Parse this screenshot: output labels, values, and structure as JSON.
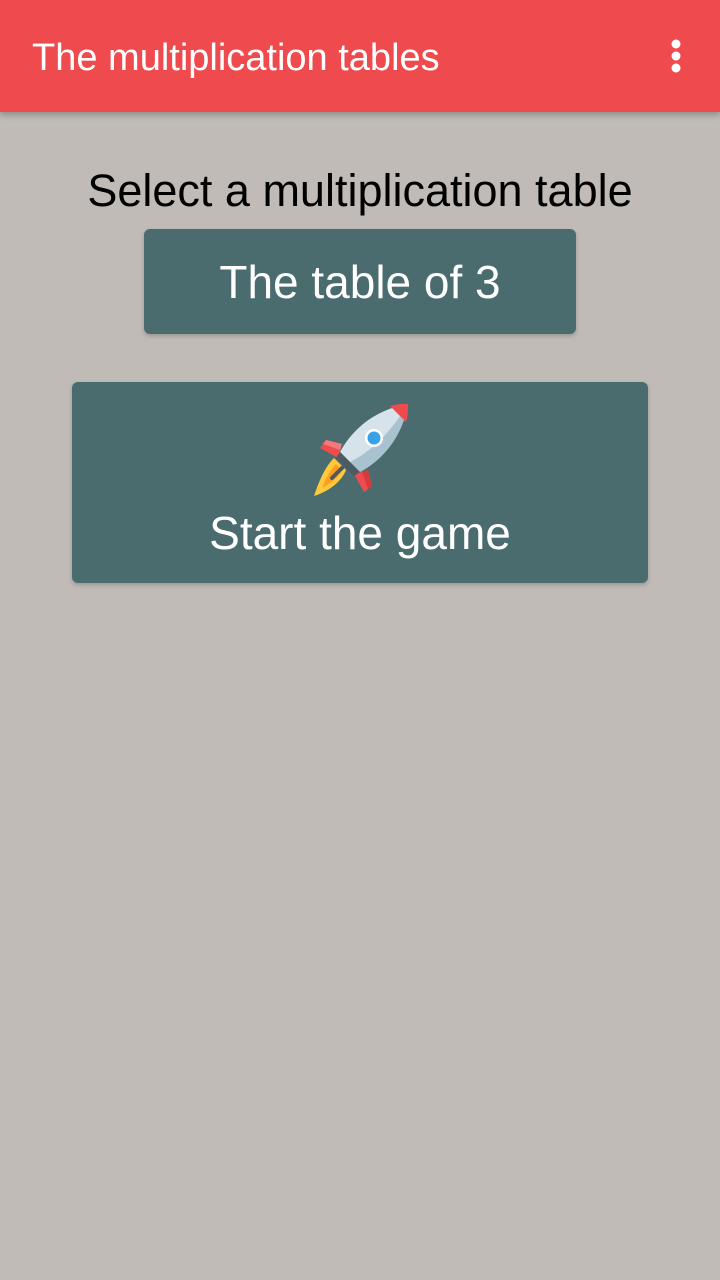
{
  "app_bar": {
    "title": "The multiplication tables",
    "background_color": "#ef4a4d",
    "overflow_icon": "more-vert-icon"
  },
  "main": {
    "prompt": "Select a multiplication table",
    "table_button_label": "The table of 3",
    "start_button": {
      "icon": "rocket-icon",
      "label": "Start the game"
    },
    "button_color": "#4a6c6f",
    "background_color": "#c0bbb6"
  }
}
